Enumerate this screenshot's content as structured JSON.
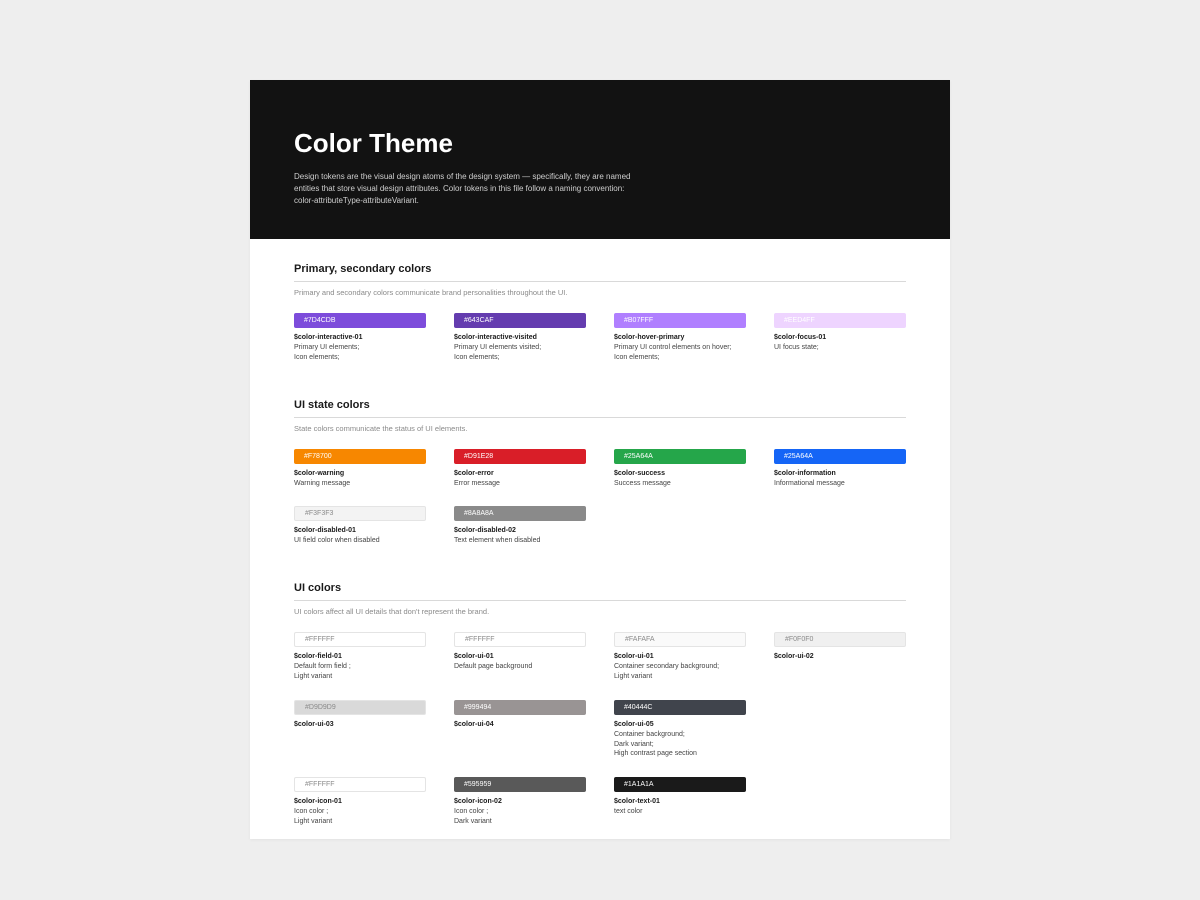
{
  "hero": {
    "title": "Color Theme",
    "description": "Design tokens are the visual design atoms of the design system — specifically, they are named entities that store visual design attributes. Color tokens in this file follow a naming convention: color-attributeType-attributeVariant."
  },
  "sections": [
    {
      "title": "Primary, secondary colors",
      "subtitle": "Primary and secondary colors communicate brand personalities throughout the UI.",
      "swatches": [
        {
          "hex": "#7D4CDB",
          "bg": "#7D4CDB",
          "light": false,
          "token": "$color-interactive-01",
          "desc": "Primary UI elements;\nIcon elements;"
        },
        {
          "hex": "#643CAF",
          "bg": "#643CAF",
          "light": false,
          "token": "$color-interactive-visited",
          "desc": "Primary UI elements visited;\nIcon elements;"
        },
        {
          "hex": "#B07FFF",
          "bg": "#B07FFF",
          "light": false,
          "token": "$color-hover-primary",
          "desc": "Primary UI control elements on hover;\nIcon elements;"
        },
        {
          "hex": "#EED4FF",
          "bg": "#EED4FF",
          "light": false,
          "token": "$color-focus-01",
          "desc": "UI focus state;"
        }
      ]
    },
    {
      "title": "UI state colors",
      "subtitle": "State colors communicate the status of UI elements.",
      "swatches": [
        {
          "hex": "#F78700",
          "bg": "#F78700",
          "light": false,
          "token": "$color-warning",
          "desc": "Warning message"
        },
        {
          "hex": "#D91E28",
          "bg": "#D91E28",
          "light": false,
          "token": "$color-error",
          "desc": "Error message"
        },
        {
          "hex": "#25A64A",
          "bg": "#25A64A",
          "light": false,
          "token": "$color-success",
          "desc": "Success message"
        },
        {
          "hex": "#25A64A",
          "bg": "#1565F6",
          "light": false,
          "token": "$color-information",
          "desc": "Informational message"
        },
        {
          "hex": "#F3F3F3",
          "bg": "#F3F3F3",
          "light": true,
          "token": "$color-disabled-01",
          "desc": "UI field color when disabled"
        },
        {
          "hex": "#8A8A8A",
          "bg": "#8A8A8A",
          "light": false,
          "token": "$color-disabled-02",
          "desc": "Text element when disabled"
        }
      ]
    },
    {
      "title": "UI colors",
      "subtitle": "UI colors affect all UI details that don't represent the brand.",
      "swatches": [
        {
          "hex": "#FFFFFF",
          "bg": "#FFFFFF",
          "light": true,
          "token": "$color-field-01",
          "desc": "Default form field ;\nLight variant"
        },
        {
          "hex": "#FFFFFF",
          "bg": "#FFFFFF",
          "light": true,
          "token": "$color-ui-01",
          "desc": "Default page background"
        },
        {
          "hex": "#FAFAFA",
          "bg": "#FAFAFA",
          "light": true,
          "token": "$color-ui-01",
          "desc": "Container secondary background;\nLight variant"
        },
        {
          "hex": "#F0F0F0",
          "bg": "#F0F0F0",
          "light": true,
          "token": "$color-ui-02",
          "desc": ""
        },
        {
          "hex": "#D9D9D9",
          "bg": "#D9D9D9",
          "light": true,
          "token": "$color-ui-03",
          "desc": ""
        },
        {
          "hex": "#999494",
          "bg": "#999494",
          "light": false,
          "token": "$color-ui-04",
          "desc": ""
        },
        {
          "hex": "#40444C",
          "bg": "#40444C",
          "light": false,
          "token": "$color-ui-05",
          "desc": "Container background;\nDark variant;\nHigh contrast page section"
        },
        {
          "hex": "",
          "bg": "",
          "light": false,
          "token": "",
          "desc": "",
          "empty": true
        },
        {
          "hex": "#FFFFFF",
          "bg": "#FFFFFF",
          "light": true,
          "token": "$color-icon-01",
          "desc": "Icon color ;\nLight variant"
        },
        {
          "hex": "#595959",
          "bg": "#595959",
          "light": false,
          "token": "$color-icon-02",
          "desc": "Icon color ;\nDark variant"
        },
        {
          "hex": "#1A1A1A",
          "bg": "#1A1A1A",
          "light": false,
          "token": "$color-text-01",
          "desc": "text color"
        }
      ]
    }
  ]
}
